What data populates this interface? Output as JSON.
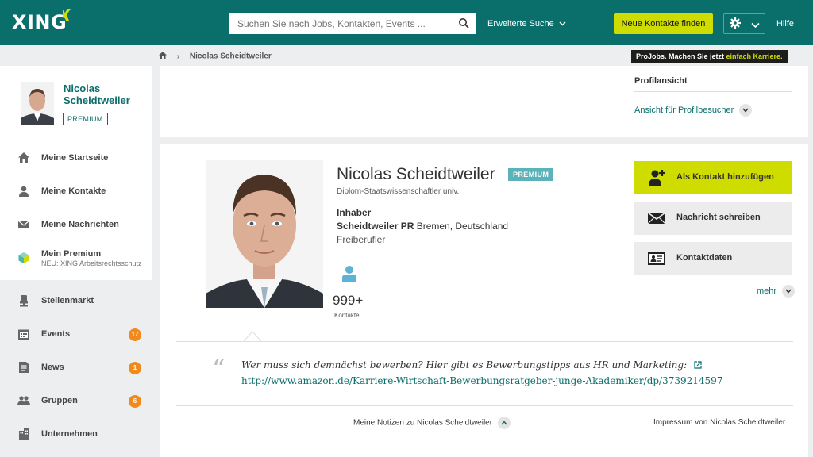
{
  "header": {
    "logo": "XING",
    "search_placeholder": "Suchen Sie nach Jobs, Kontakten, Events ...",
    "advanced_search": "Erweiterte Suche",
    "find_contacts": "Neue Kontakte finden",
    "help": "Hilfe"
  },
  "breadcrumb": {
    "current": "Nicolas Scheidtweiler"
  },
  "projobs": {
    "prefix": "ProJobs. Machen Sie jetzt ",
    "highlight": "einfach Karriere."
  },
  "sidebar": {
    "name": "Nicolas Scheidtweiler",
    "premium": "PREMIUM",
    "items": [
      {
        "label": "Meine Startseite",
        "icon": "home-icon"
      },
      {
        "label": "Meine Kontakte",
        "icon": "contacts-icon"
      },
      {
        "label": "Meine Nachrichten",
        "icon": "mail-icon"
      },
      {
        "label": "Mein Premium",
        "sub": "NEU: XING Arbeitsrechtsschutz",
        "icon": "premium-cube-icon"
      }
    ],
    "items2": [
      {
        "label": "Stellenmarkt",
        "icon": "chair-icon"
      },
      {
        "label": "Events",
        "count": "17",
        "icon": "calendar-icon"
      },
      {
        "label": "News",
        "count": "1",
        "icon": "news-icon"
      },
      {
        "label": "Gruppen",
        "count": "6",
        "icon": "groups-icon"
      },
      {
        "label": "Unternehmen",
        "icon": "company-icon"
      }
    ]
  },
  "profile_view": {
    "title": "Profilansicht",
    "link": "Ansicht für Profilbesucher"
  },
  "profile": {
    "name": "Nicolas Scheidtweiler",
    "badge": "PREMIUM",
    "title": "Diplom-Staatswissenschaftler univ.",
    "position": "Inhaber",
    "company": "Scheidtweiler PR",
    "location": " Bremen, Deutschland",
    "status": "Freiberufler",
    "contacts_count": "999+",
    "contacts_label": "Kontakte"
  },
  "actions": {
    "add_contact": "Als Kontakt hinzufügen",
    "message": "Nachricht schreiben",
    "contact_data": "Kontaktdaten",
    "more": "mehr"
  },
  "quote": {
    "text": "Wer muss sich demnächst bewerben? Hier gibt es Bewerbungstipps aus HR und Marketing:",
    "link": "http://www.amazon.de/Karriere-Wirtschaft-Bewerbungsratgeber-junge-Akademiker/dp/3739214597"
  },
  "footer_links": {
    "notes": "Meine Notizen zu Nicolas Scheidtweiler",
    "impressum": "Impressum von Nicolas Scheidtweiler"
  },
  "colors": {
    "brand": "#0a6e6b",
    "accent": "#cfdc00",
    "count_badge": "#f28a1b"
  }
}
